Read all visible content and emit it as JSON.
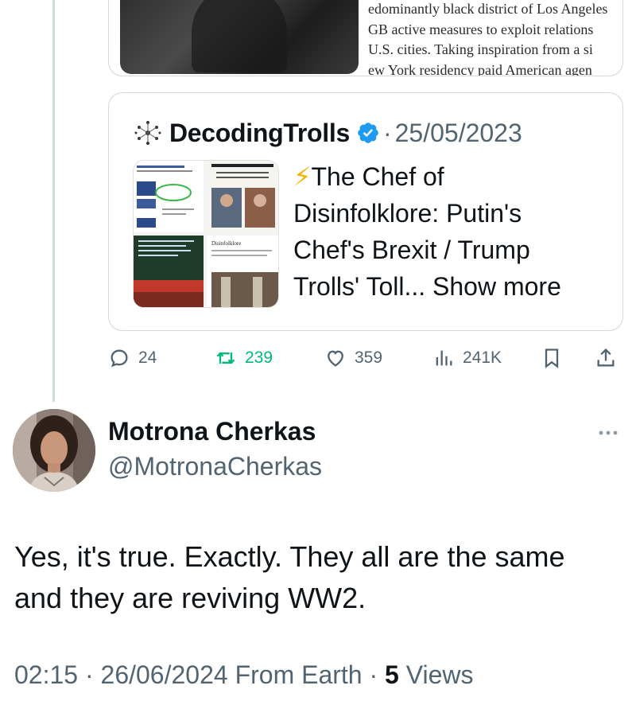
{
  "top_card": {
    "article_lines": [
      "edominantly black district of Los Angeles",
      "GB active measures to exploit relations",
      "U.S. cities. Taking inspiration from a si",
      "ew York residency paid American agen"
    ]
  },
  "quote": {
    "author": "DecodingTrolls",
    "separator": "·",
    "date": "25/05/2023",
    "emoji": "⚡",
    "text_lines": [
      "The Chef of",
      "Disinfolklore: Putin's",
      "Chef's Brexit / Trump"
    ],
    "last_line": "Trolls' Toll...",
    "show_more": "Show more",
    "thumb_labels": [
      "Disinfolklore"
    ]
  },
  "actions": {
    "replies": "24",
    "retweets": "239",
    "likes": "359",
    "views": "241K"
  },
  "reply": {
    "name": "Motrona Cherkas",
    "handle": "@MotronaCherkas",
    "text_line1": "Yes, it's true. Exactly. They all are the same",
    "text_line2": "and they are reviving WW2.",
    "time": "02:15",
    "date_location": "· 26/06/2024 From Earth ·",
    "views_count": "5",
    "views_label": "Views"
  },
  "colors": {
    "accent_blue": "#1d9bf0",
    "retweet_green": "#00ba7c",
    "muted": "#536471"
  }
}
